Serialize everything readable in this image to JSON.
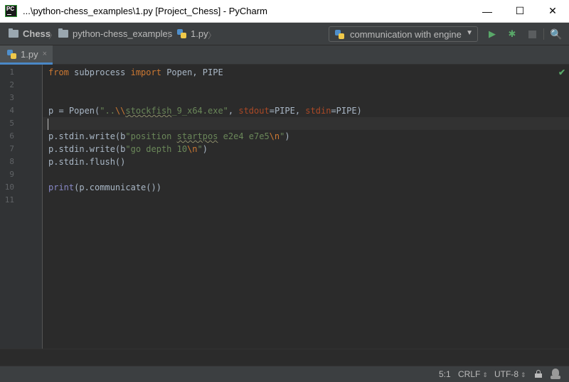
{
  "window": {
    "title": "...\\python-chess_examples\\1.py [Project_Chess] - PyCharm",
    "min_glyph": "—",
    "max_glyph": "☐",
    "close_glyph": "✕"
  },
  "breadcrumbs": {
    "project": "Chess",
    "folder": "python-chess_examples",
    "file": "1.py"
  },
  "toolbar": {
    "run_config": "communication with engine",
    "run_glyph": "▶",
    "debug_glyph": "✱",
    "search_glyph": "🔍"
  },
  "tab": {
    "label": "1.py",
    "close_glyph": "×"
  },
  "gutter": {
    "line_numbers": [
      "1",
      "2",
      "3",
      "4",
      "5",
      "6",
      "7",
      "8",
      "9",
      "10",
      "11"
    ]
  },
  "code": {
    "l1": {
      "kw1": "from",
      "mod": " subprocess ",
      "kw2": "import",
      "rest": " Popen, PIPE"
    },
    "l4": {
      "a": "p = Popen(",
      "s1": "\"..",
      "s_esc": "\\\\",
      "s_sq": "stockfish",
      "s2": "_9_x64.exe\"",
      "b": ", ",
      "p1": "stdout",
      "c": "=PIPE, ",
      "p2": "stdin",
      "d": "=PIPE)"
    },
    "l6": {
      "a": "p.stdin.write(b",
      "s1": "\"position ",
      "s_sq": "startpos",
      "s2": " e2e4 e7e5",
      "esc": "\\n",
      "s3": "\"",
      "b": ")"
    },
    "l7": {
      "a": "p.stdin.write(b",
      "s1": "\"go depth 10",
      "esc": "\\n",
      "s3": "\"",
      "b": ")"
    },
    "l8": {
      "a": "p.stdin.flush()"
    },
    "l10": {
      "fn": "print",
      "a": "(p.communicate())"
    }
  },
  "status": {
    "position": "5:1",
    "line_sep": "CRLF",
    "encoding": "UTF-8",
    "updn": "⇕"
  },
  "colors": {
    "keyword": "#cc7832",
    "string": "#6a8759",
    "builtin": "#8888c6",
    "param": "#aa4926",
    "text": "#a9b7c6",
    "run_green": "#59a869",
    "tab_underline": "#4a88c7"
  }
}
